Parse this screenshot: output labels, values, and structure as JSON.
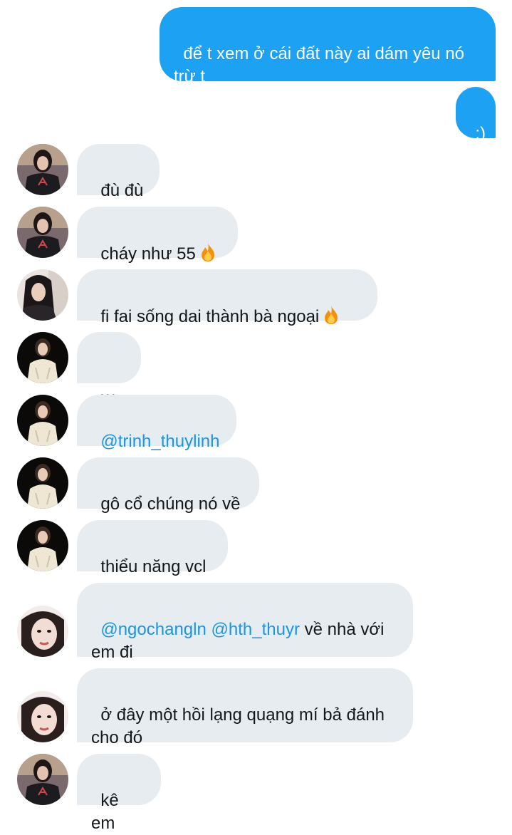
{
  "messages": [
    {
      "id": "m1",
      "side": "out",
      "text": "để t xem ở cái đất này ai dám yêu nó trừ t"
    },
    {
      "id": "m2",
      "side": "out",
      "text": ":)"
    },
    {
      "id": "m3",
      "side": "in",
      "avatar": "avatar-a",
      "text": "đù đù"
    },
    {
      "id": "m4",
      "side": "in",
      "avatar": "avatar-a",
      "text": "cháy như 55",
      "emoji": "fire-emoji"
    },
    {
      "id": "m5",
      "side": "in",
      "avatar": "avatar-b",
      "text": "fi fai sống dai thành bà ngoại",
      "emoji": "fire-emoji"
    },
    {
      "id": "m6",
      "side": "in",
      "avatar": "avatar-c",
      "text": "=)))"
    },
    {
      "id": "m7",
      "side": "in",
      "avatar": "avatar-c",
      "mention": "@trinh_thuylinh"
    },
    {
      "id": "m8",
      "side": "in",
      "avatar": "avatar-c",
      "text": "gô cổ chúng nó về"
    },
    {
      "id": "m9",
      "side": "in",
      "avatar": "avatar-c",
      "text": "thiểu năng vcl"
    },
    {
      "id": "m10",
      "side": "in",
      "avatar": "avatar-d",
      "mention1": "@ngochangln",
      "mention2": "@hth_thuyr",
      "text_after": " về nhà với em đi"
    },
    {
      "id": "m11",
      "side": "in",
      "avatar": "avatar-d",
      "text": "ở đây một hồi lạng quạng mí bả đánh cho đó"
    },
    {
      "id": "m12",
      "side": "in",
      "avatar": "avatar-a",
      "text": "kê em"
    }
  ],
  "colors": {
    "outgoing_bubble": "#1da1f2",
    "incoming_bubble": "#e6ecf0",
    "mention": "#1b95e0"
  }
}
